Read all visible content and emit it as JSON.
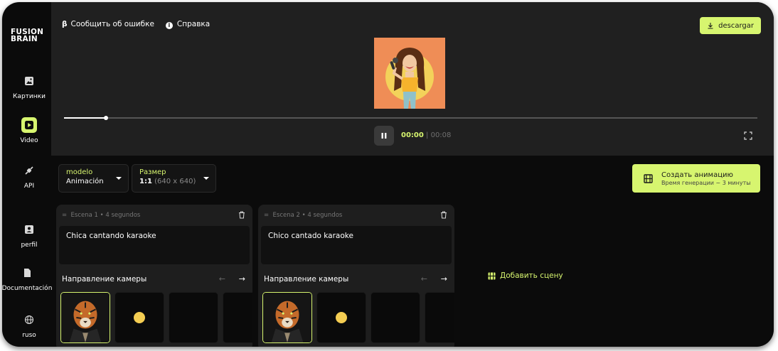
{
  "brand": {
    "logo_line1": "FUSION",
    "logo_line2": "BRAIN"
  },
  "nav": [
    {
      "label": "Картинки",
      "icon": "image-icon",
      "active": false
    },
    {
      "label": "Video",
      "icon": "play-icon",
      "active": true
    },
    {
      "label": "API",
      "icon": "plug-icon",
      "active": false
    },
    {
      "label": "perfil",
      "icon": "profile-icon",
      "active": false
    },
    {
      "label": "Documentación",
      "icon": "document-icon",
      "active": false
    },
    {
      "label": "ruso",
      "icon": "globe-icon",
      "active": false
    }
  ],
  "header": {
    "beta_symbol": "β",
    "report_label": "Сообщить об ошибке",
    "help_label": "Справка",
    "download_label": "descargar"
  },
  "player": {
    "progress_fraction": 0.06,
    "time_current": "00:00",
    "time_separator": " | ",
    "time_total": "00:08"
  },
  "controls": {
    "model_label": "modelo",
    "model_value": "Animación",
    "size_label": "Размер",
    "size_ratio": "1:1",
    "size_pixels": "(640 x 640)",
    "create_title": "Создать анимацию",
    "create_subtitle": "Время генерации ~ 3 минуты"
  },
  "scenes": [
    {
      "header": "Escena 1 • 4 segundos",
      "prompt": "Chica cantando karaoke",
      "camera_label": "Направление камеры"
    },
    {
      "header": "Escena 2 • 4 segundos",
      "prompt": "Chico cantado karaoke",
      "camera_label": "Направление камеры"
    }
  ],
  "add_scene_label": "Добавить сцену",
  "colors": {
    "accent": "#d7f56f",
    "panel": "#202020",
    "background": "#0b0b0b"
  }
}
